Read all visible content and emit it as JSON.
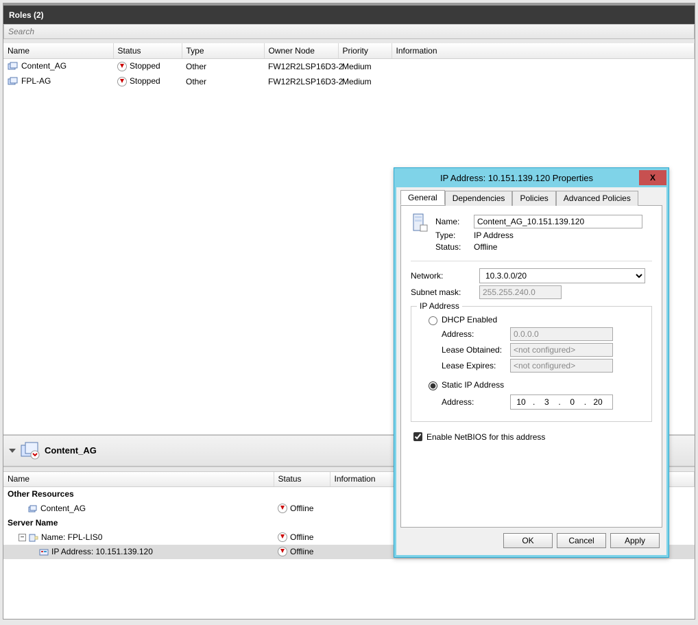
{
  "header": {
    "title": "Roles (2)"
  },
  "search": {
    "placeholder": "Search"
  },
  "columns": {
    "name": "Name",
    "status": "Status",
    "type": "Type",
    "owner": "Owner Node",
    "priority": "Priority",
    "info": "Information"
  },
  "roles": [
    {
      "name": "Content_AG",
      "status": "Stopped",
      "type": "Other",
      "owner": "FW12R2LSP16D3-2",
      "priority": "Medium",
      "info": ""
    },
    {
      "name": "FPL-AG",
      "status": "Stopped",
      "type": "Other",
      "owner": "FW12R2LSP16D3-2",
      "priority": "Medium",
      "info": ""
    }
  ],
  "detail": {
    "title": "Content_AG",
    "columns": {
      "name": "Name",
      "status": "Status",
      "info": "Information"
    },
    "groups": {
      "other": "Other Resources",
      "server": "Server Name"
    },
    "rows": {
      "content_ag": {
        "name": "Content_AG",
        "status": "Offline"
      },
      "name_row": {
        "name": "Name: FPL-LIS0",
        "status": "Offline"
      },
      "ip_row": {
        "name": "IP Address: 10.151.139.120",
        "status": "Offline"
      }
    },
    "expander": "⊟"
  },
  "dialog": {
    "title": "IP Address: 10.151.139.120 Properties",
    "tabs": {
      "general": "General",
      "deps": "Dependencies",
      "policies": "Policies",
      "adv": "Advanced Policies"
    },
    "labels": {
      "name": "Name:",
      "type": "Type:",
      "status": "Status:",
      "network": "Network:",
      "subnet": "Subnet mask:",
      "ipaddress_group": "IP Address",
      "dhcp": "DHCP Enabled",
      "address": "Address:",
      "lease_obt": "Lease Obtained:",
      "lease_exp": "Lease Expires:",
      "static": "Static IP Address",
      "netbios": "Enable NetBIOS for this address"
    },
    "values": {
      "name": "Content_AG_10.151.139.120",
      "type": "IP Address",
      "status": "Offline",
      "network": "10.3.0.0/20",
      "subnet": "255.255.240.0",
      "dhcp_address": "0.0.0.0",
      "lease_obt": "<not configured>",
      "lease_exp": "<not configured>",
      "static_ip": {
        "a": "10",
        "b": "3",
        "c": "0",
        "d": "20"
      }
    },
    "buttons": {
      "ok": "OK",
      "cancel": "Cancel",
      "apply": "Apply"
    }
  }
}
